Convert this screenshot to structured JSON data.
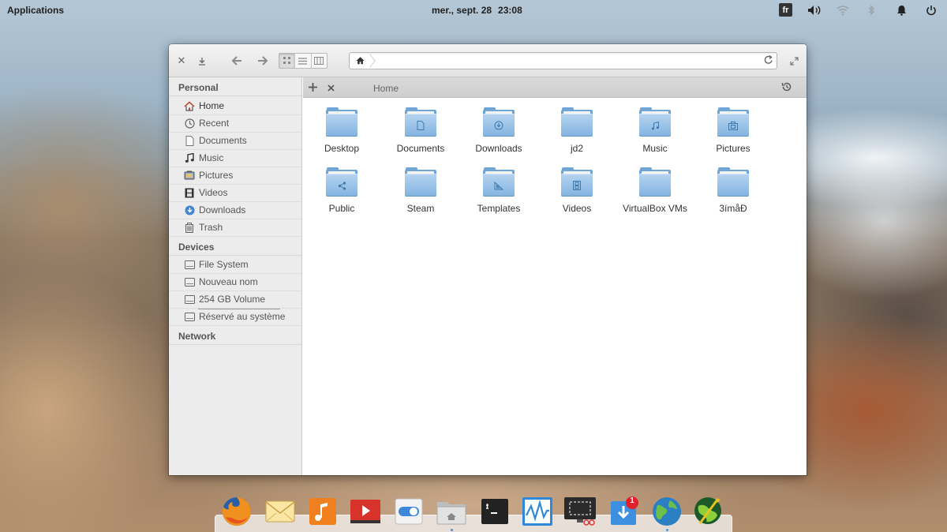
{
  "panel": {
    "applications": "Applications",
    "date": "mer., sept. 28",
    "time": "23:08",
    "language": "fr",
    "icons": [
      "volume-icon",
      "wifi-icon",
      "bluetooth-icon",
      "notifications-icon",
      "power-icon"
    ]
  },
  "toolbar": {
    "close_icon": "close-icon",
    "download_icon": "download-icon",
    "back_icon": "back-arrow-icon",
    "forward_icon": "forward-arrow-icon",
    "view_modes": [
      "icon-view",
      "list-view",
      "column-view"
    ],
    "active_view": "icon-view",
    "path": ""
  },
  "sidebar": {
    "sections": {
      "personal": "Personal",
      "devices": "Devices",
      "network": "Network"
    },
    "personal_items": [
      {
        "label": "Home",
        "icon": "home-icon"
      },
      {
        "label": "Recent",
        "icon": "recent-icon"
      },
      {
        "label": "Documents",
        "icon": "document-icon"
      },
      {
        "label": "Music",
        "icon": "music-icon"
      },
      {
        "label": "Pictures",
        "icon": "pictures-icon"
      },
      {
        "label": "Videos",
        "icon": "videos-icon"
      },
      {
        "label": "Downloads",
        "icon": "downloads-icon"
      },
      {
        "label": "Trash",
        "icon": "trash-icon"
      }
    ],
    "device_items": [
      {
        "label": "File System",
        "icon": "drive-icon"
      },
      {
        "label": "Nouveau nom",
        "icon": "drive-icon"
      },
      {
        "label": "254 GB Volume",
        "icon": "drive-icon"
      },
      {
        "label": "Réservé au système",
        "icon": "drive-icon"
      }
    ]
  },
  "tabs": {
    "add_icon": "plus-icon",
    "close_icon": "close-icon",
    "current": "Home",
    "history_icon": "history-icon"
  },
  "files": [
    {
      "label": "Desktop",
      "emblem": ""
    },
    {
      "label": "Documents",
      "emblem": "document"
    },
    {
      "label": "Downloads",
      "emblem": "download"
    },
    {
      "label": "jd2",
      "emblem": ""
    },
    {
      "label": "Music",
      "emblem": "music"
    },
    {
      "label": "Pictures",
      "emblem": "picture"
    },
    {
      "label": "Public",
      "emblem": "share"
    },
    {
      "label": "Steam",
      "emblem": ""
    },
    {
      "label": "Templates",
      "emblem": "template"
    },
    {
      "label": "Videos",
      "emblem": "video"
    },
    {
      "label": "VirtualBox VMs",
      "emblem": ""
    },
    {
      "label": "3ímåÐ",
      "emblem": ""
    }
  ],
  "dock": {
    "apps": [
      "firefox-icon",
      "mail-icon",
      "music-player-icon",
      "video-player-icon",
      "settings-toggle-icon",
      "files-icon",
      "terminal-icon",
      "system-monitor-icon",
      "screenshot-icon",
      "updater-icon",
      "browser-globe-icon",
      "map-globe-icon"
    ],
    "badge": "1"
  },
  "colors": {
    "folder": "#82b3e0",
    "accent": "#4a90d9",
    "badge": "#e0202a"
  }
}
